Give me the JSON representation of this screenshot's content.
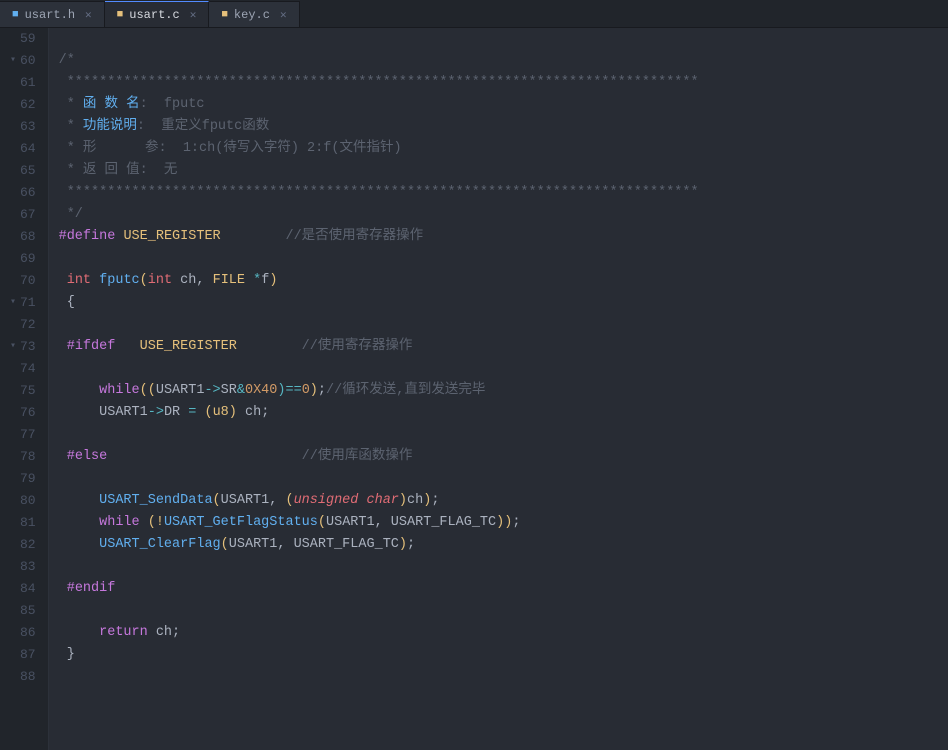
{
  "tabs": [
    {
      "id": "usart-h",
      "label": "usart.h",
      "icon": "h",
      "active": false
    },
    {
      "id": "usart-c",
      "label": "usart.c",
      "icon": "c",
      "active": true
    },
    {
      "id": "key-c",
      "label": "key.c",
      "icon": "c",
      "active": false
    }
  ],
  "lines": [
    {
      "num": 59,
      "fold": null,
      "content": ""
    },
    {
      "num": 60,
      "fold": "open",
      "content": "/*"
    },
    {
      "num": 61,
      "fold": null,
      "content": " ******************************************************************************"
    },
    {
      "num": 62,
      "fold": null,
      "content": " * 函 数 名:  fputc"
    },
    {
      "num": 63,
      "fold": null,
      "content": " * 功能说明:  重定义fputc函数"
    },
    {
      "num": 64,
      "fold": null,
      "content": " * 形      参:  1:ch(待写入字符) 2:f(文件指针)"
    },
    {
      "num": 65,
      "fold": null,
      "content": " * 返 回 值:  无"
    },
    {
      "num": 66,
      "fold": null,
      "content": " ******************************************************************************"
    },
    {
      "num": 67,
      "fold": null,
      "content": " */"
    },
    {
      "num": 68,
      "fold": null,
      "content": "#define USE_REGISTER        //是否使用寄存器操作"
    },
    {
      "num": 69,
      "fold": null,
      "content": ""
    },
    {
      "num": 70,
      "fold": null,
      "content": " int fputc(int ch, FILE *f)"
    },
    {
      "num": 71,
      "fold": "open",
      "content": " {"
    },
    {
      "num": 72,
      "fold": null,
      "content": ""
    },
    {
      "num": 73,
      "fold": "open",
      "content": " #ifdef   USE_REGISTER        //使用寄存器操作"
    },
    {
      "num": 74,
      "fold": null,
      "content": ""
    },
    {
      "num": 75,
      "fold": null,
      "content": "     while((USART1->SR&0X40)==0);//循环发送,直到发送完毕"
    },
    {
      "num": 76,
      "fold": null,
      "content": "     USART1->DR = (u8) ch;"
    },
    {
      "num": 77,
      "fold": null,
      "content": ""
    },
    {
      "num": 78,
      "fold": null,
      "content": " #else                        //使用库函数操作"
    },
    {
      "num": 79,
      "fold": null,
      "content": ""
    },
    {
      "num": 80,
      "fold": null,
      "content": "     USART_SendData(USART1, (unsigned char)ch);"
    },
    {
      "num": 81,
      "fold": null,
      "content": "     while (!USART_GetFlagStatus(USART1, USART_FLAG_TC));"
    },
    {
      "num": 82,
      "fold": null,
      "content": "     USART_ClearFlag(USART1, USART_FLAG_TC);"
    },
    {
      "num": 83,
      "fold": null,
      "content": ""
    },
    {
      "num": 84,
      "fold": null,
      "content": " #endif"
    },
    {
      "num": 85,
      "fold": null,
      "content": ""
    },
    {
      "num": 86,
      "fold": null,
      "content": "     return ch;"
    },
    {
      "num": 87,
      "fold": null,
      "content": " }"
    },
    {
      "num": 88,
      "fold": null,
      "content": ""
    }
  ]
}
